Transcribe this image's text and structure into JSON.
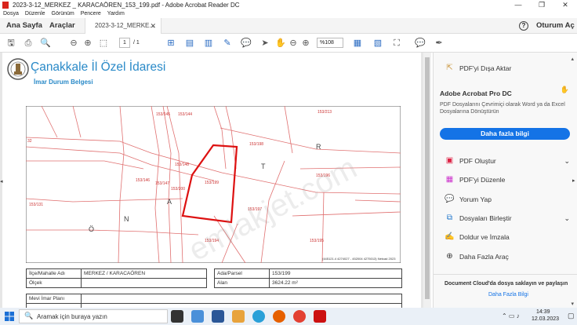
{
  "window": {
    "title": "2023-3-12_MERKEZ _ KARACAÖREN_153_199.pdf - Adobe Acrobat Reader DC",
    "minimize": "—",
    "maximize": "❐",
    "close": "✕"
  },
  "menu": [
    "Dosya",
    "Düzenle",
    "Görünüm",
    "Pencere",
    "Yardım"
  ],
  "tabs": {
    "home": "Ana Sayfa",
    "tools": "Araçlar",
    "doc": "2023-3-12_MERKE...",
    "help": "?",
    "signin": "Oturum Aç"
  },
  "toolbar": {
    "page_current": "1",
    "page_total": "/ 1",
    "zoom": "%108"
  },
  "document": {
    "org_title": "Çanakkale İl Özel İdaresi",
    "doc_subtitle": "İmar Durum Belgesi",
    "map_parcels": [
      "153/145",
      "153/144",
      "153/213",
      "153/198",
      "153/148",
      "153/199",
      "153/196",
      "153/200",
      "153/147",
      "153/146",
      "153/197",
      "153/131",
      "153/194",
      "153/195",
      "32"
    ],
    "map_letters": [
      "R",
      "T",
      "A",
      "N",
      "Ö"
    ],
    "map_caption": "(445121.4 4274027 - 452004 4275013) Netcad 2023",
    "watermark": "emlakjet.com",
    "table": {
      "r1": [
        "İlçe/Mahalle Adı",
        "MERKEZ / KARACAÖREN",
        "Ada/Parsel",
        "153/199"
      ],
      "r2": [
        "Ölçek",
        "",
        "Alan",
        "3624.22 m²"
      ],
      "r3_label": "Mevi İmar Planı"
    }
  },
  "right_pane": {
    "export": "PDF'yi Dışa Aktar",
    "promo_title": "Adobe Acrobat Pro DC",
    "promo_text": "PDF Dosyalarını Çevrimiçi olarak Word ya da Excel Dosyalarına Dönüştürün",
    "promo_button": "Daha fazla bilgi",
    "tools": [
      "PDF Oluştur",
      "PDF'yi Düzenle",
      "Yorum Yap",
      "Dosyaları Birleştir",
      "Doldur ve İmzala",
      "Daha Fazla Araç"
    ],
    "cloud_text": "Document Cloud'da dosya saklayın ve paylaşın",
    "cloud_link": "Daha Fazla Bilgi"
  },
  "taskbar": {
    "search_placeholder": "Aramak için buraya yazın",
    "time": "14:39",
    "date": "12.03.2023"
  },
  "colors": {
    "accent_blue": "#1473e6",
    "parcel_red": "#e07070",
    "highlight_red": "#d11",
    "title_blue": "#2a8ac8"
  }
}
